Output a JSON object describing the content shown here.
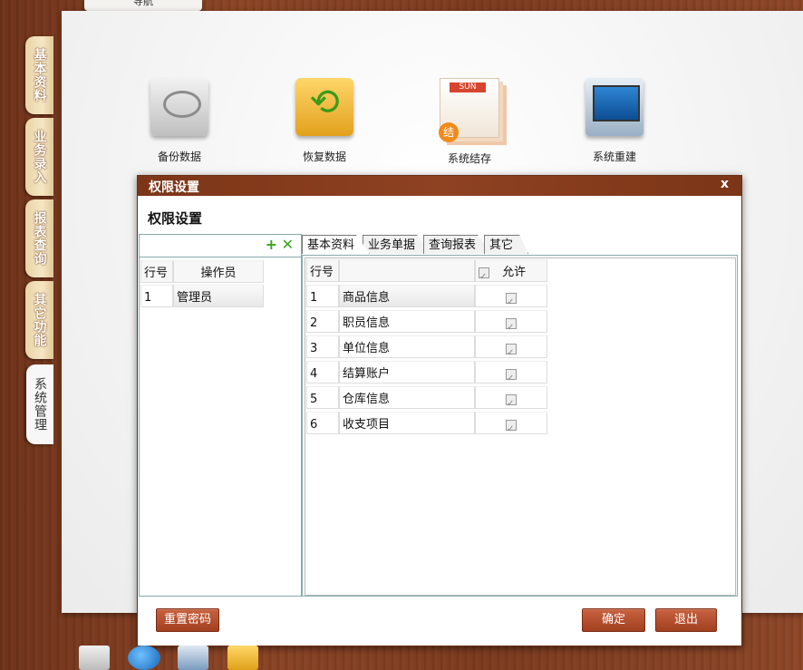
{
  "top_tab": {
    "label": "导航"
  },
  "side_tabs": [
    "基本资料",
    "业务录入",
    "报表查询",
    "其它功能",
    "系统管理"
  ],
  "tools": [
    {
      "label": "备份数据",
      "icon": "hard-drive-icon"
    },
    {
      "label": "恢复数据",
      "icon": "restore-icon"
    },
    {
      "label": "系统结存",
      "icon": "carry-forward-icon"
    },
    {
      "label": "系统重建",
      "icon": "monitor-icon"
    }
  ],
  "dialog": {
    "title": "权限设置",
    "heading": "权限设置",
    "close_symbol": "x",
    "toolbar": {
      "add_symbol": "+",
      "delete_symbol": "✕"
    },
    "operator_grid": {
      "headers": [
        "行号",
        "操作员"
      ],
      "rows": [
        {
          "no": "1",
          "name": "管理员"
        }
      ]
    },
    "tabs": [
      "基本资料",
      "业务单据",
      "查询报表",
      "其它"
    ],
    "permission_grid": {
      "headers": {
        "no": "行号",
        "name": "",
        "allow": "允许"
      },
      "rows": [
        {
          "no": "1",
          "name": "商品信息",
          "allow": true
        },
        {
          "no": "2",
          "name": "职员信息",
          "allow": true
        },
        {
          "no": "3",
          "name": "单位信息",
          "allow": true
        },
        {
          "no": "4",
          "name": "结算账户",
          "allow": true
        },
        {
          "no": "5",
          "name": "仓库信息",
          "allow": true
        },
        {
          "no": "6",
          "name": "收支项目",
          "allow": true
        }
      ]
    },
    "buttons": {
      "reset_password": "重置密码",
      "ok": "确定",
      "exit": "退出"
    }
  }
}
